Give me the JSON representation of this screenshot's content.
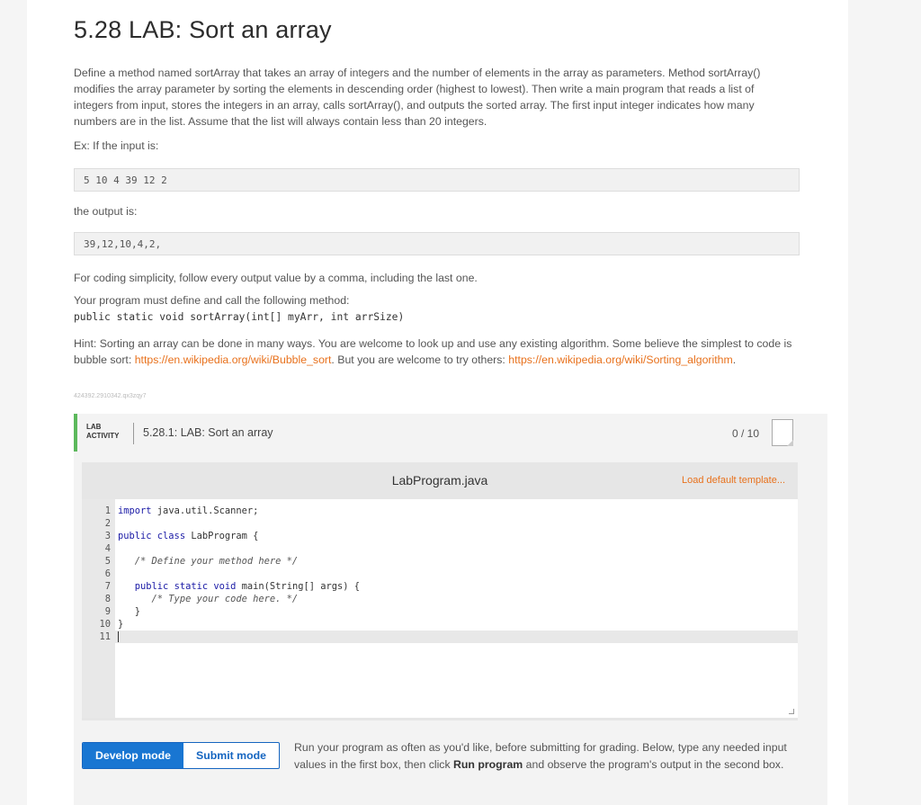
{
  "page": {
    "title": "5.28 LAB: Sort an array",
    "description": "Define a method named sortArray that takes an array of integers and the number of elements in the array as parameters. Method sortArray() modifies the array parameter by sorting the elements in descending order (highest to lowest). Then write a main program that reads a list of integers from input, stores the integers in an array, calls sortArray(), and outputs the sorted array. The first input integer indicates how many numbers are in the list. Assume that the list will always contain less than 20 integers.",
    "example_label": "Ex: If the input is:",
    "example_input": "5 10 4 39 12 2",
    "output_label": "the output is:",
    "example_output": "39,12,10,4,2,",
    "simplicity_note": "For coding simplicity, follow every output value by a comma, including the last one.",
    "method_intro": "Your program must define and call the following method:",
    "method_signature": "public static void sortArray(int[] myArr, int arrSize)",
    "hint_text_1": "Hint: Sorting an array can be done in many ways. You are welcome to look up and use any existing algorithm. Some believe the simplest to code is bubble sort: ",
    "hint_link_1": "https://en.wikipedia.org/wiki/Bubble_sort",
    "hint_text_2": ". But you are welcome to try others: ",
    "hint_link_2": "https://en.wikipedia.org/wiki/Sorting_algorithm",
    "hint_text_3": ".",
    "content_id": "424392.2910342.qx3zqy7"
  },
  "lab": {
    "badge_line1": "LAB",
    "badge_line2": "ACTIVITY",
    "title": "5.28.1: LAB: Sort an array",
    "score": "0 / 10",
    "accent_color": "#5cb85c"
  },
  "editor": {
    "filename": "LabProgram.java",
    "load_template": "Load default template...",
    "lines": [
      {
        "n": "1",
        "code": "import java.util.Scanner;"
      },
      {
        "n": "2",
        "code": ""
      },
      {
        "n": "3",
        "code": "public class LabProgram {"
      },
      {
        "n": "4",
        "code": ""
      },
      {
        "n": "5",
        "code": "   /* Define your method here */"
      },
      {
        "n": "6",
        "code": ""
      },
      {
        "n": "7",
        "code": "   public static void main(String[] args) {"
      },
      {
        "n": "8",
        "code": "      /* Type your code here. */"
      },
      {
        "n": "9",
        "code": "   }"
      },
      {
        "n": "10",
        "code": "}"
      },
      {
        "n": "11",
        "code": ""
      }
    ]
  },
  "modes": {
    "develop": "Develop mode",
    "submit": "Submit mode",
    "help_1": "Run your program as often as you'd like, before submitting for grading. Below, type any needed input values in the first box, then click ",
    "help_bold": "Run program",
    "help_2": " and observe the program's output in the second box.",
    "active_color": "#1976d2"
  }
}
